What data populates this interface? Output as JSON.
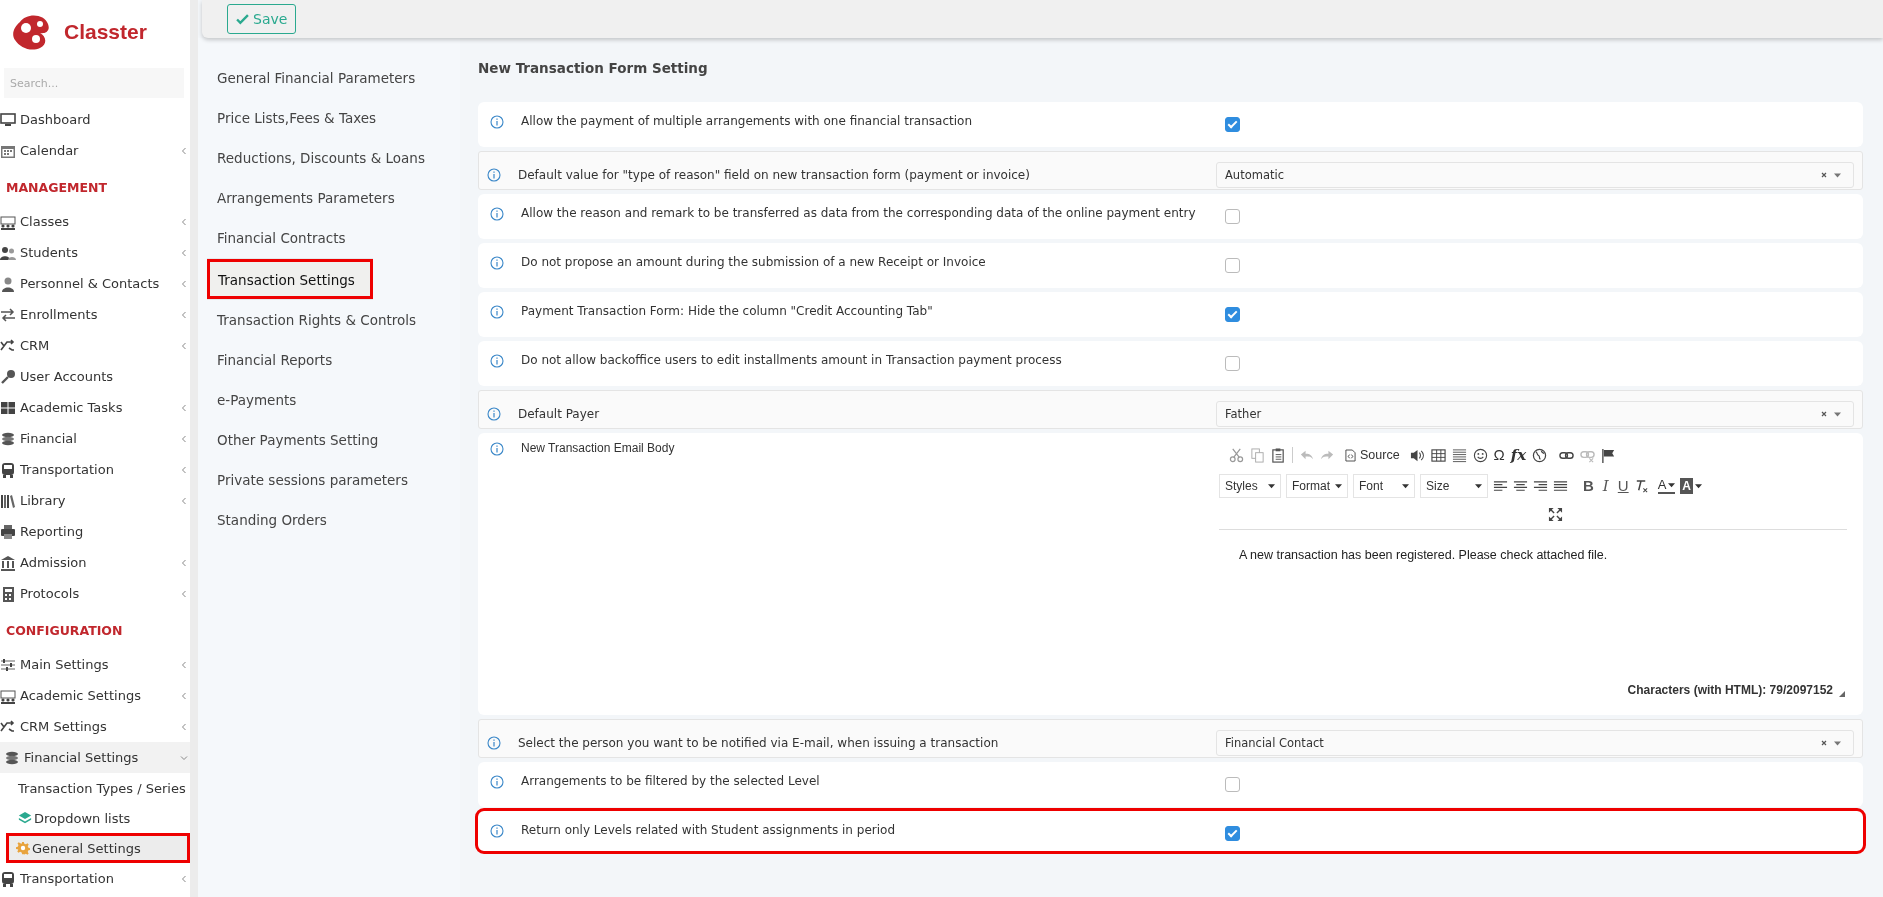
{
  "app": {
    "name": "Classter"
  },
  "sidebar": {
    "search": {
      "placeholder": "Search..."
    },
    "sections": [
      {
        "items": [
          {
            "label": "Dashboard",
            "has_submenu": false
          },
          {
            "label": "Calendar",
            "has_submenu": true,
            "expanded": false
          }
        ]
      },
      {
        "title": "MANAGEMENT",
        "items": [
          {
            "label": "Classes",
            "has_submenu": true,
            "expanded": false
          },
          {
            "label": "Students",
            "has_submenu": true,
            "expanded": false
          },
          {
            "label": "Personnel & Contacts",
            "has_submenu": true,
            "expanded": false
          },
          {
            "label": "Enrollments",
            "has_submenu": true,
            "expanded": false
          },
          {
            "label": "CRM",
            "has_submenu": true,
            "expanded": false
          },
          {
            "label": "User Accounts",
            "has_submenu": false
          },
          {
            "label": "Academic Tasks",
            "has_submenu": true,
            "expanded": false
          },
          {
            "label": "Financial",
            "has_submenu": true,
            "expanded": false
          },
          {
            "label": "Transportation",
            "has_submenu": true,
            "expanded": false
          },
          {
            "label": "Library",
            "has_submenu": true,
            "expanded": false
          },
          {
            "label": "Reporting",
            "has_submenu": false
          },
          {
            "label": "Admission",
            "has_submenu": true,
            "expanded": false
          },
          {
            "label": "Protocols",
            "has_submenu": true,
            "expanded": false
          }
        ]
      },
      {
        "title": "CONFIGURATION",
        "items": [
          {
            "label": "Main Settings",
            "has_submenu": true,
            "expanded": false
          },
          {
            "label": "Academic Settings",
            "has_submenu": true,
            "expanded": false
          },
          {
            "label": "CRM Settings",
            "has_submenu": true,
            "expanded": false
          },
          {
            "label": "Financial Settings",
            "has_submenu": true,
            "expanded": true,
            "children": [
              {
                "label": "Transaction Types / Series",
                "selected": false,
                "highlighted": false
              },
              {
                "label": "Dropdown lists",
                "selected": false,
                "highlighted": false
              },
              {
                "label": "General Settings",
                "selected": true,
                "highlighted": true
              }
            ]
          },
          {
            "label": "Transportation",
            "has_submenu": true,
            "expanded": false
          }
        ]
      }
    ]
  },
  "toolbar": {
    "save_button": "Save"
  },
  "settings_menu": [
    {
      "label": "General Financial Parameters",
      "selected": false,
      "highlighted": false
    },
    {
      "label": "Price Lists,Fees & Taxes",
      "selected": false,
      "highlighted": false
    },
    {
      "label": "Reductions, Discounts & Loans",
      "selected": false,
      "highlighted": false
    },
    {
      "label": "Arrangements Parameters",
      "selected": false,
      "highlighted": false
    },
    {
      "label": "Financial Contracts",
      "selected": false,
      "highlighted": false
    },
    {
      "label": "Transaction Settings",
      "selected": true,
      "highlighted": true
    },
    {
      "label": "Transaction Rights & Controls",
      "selected": false,
      "highlighted": false
    },
    {
      "label": "Financial Reports",
      "selected": false,
      "highlighted": false
    },
    {
      "label": "e-Payments",
      "selected": false,
      "highlighted": false
    },
    {
      "label": "Other Payments Setting",
      "selected": false,
      "highlighted": false
    },
    {
      "label": "Private sessions parameters",
      "selected": false,
      "highlighted": false
    },
    {
      "label": "Standing Orders",
      "selected": false,
      "highlighted": false
    }
  ],
  "form": {
    "title": "New Transaction Form Setting",
    "rows": [
      {
        "kind": "checkbox",
        "label": "Allow the payment of multiple arrangements with one financial transaction",
        "checked": true,
        "highlighted": false
      },
      {
        "kind": "select",
        "label": "Default value for \"type of reason\" field on new transaction form (payment or invoice)",
        "value": "Automatic",
        "highlighted": false
      },
      {
        "kind": "checkbox",
        "label": "Allow the reason and remark to be transferred as data from the corresponding data of the online payment entry",
        "checked": false,
        "highlighted": false
      },
      {
        "kind": "checkbox",
        "label": "Do not propose an amount during the submission of a new Receipt or Invoice",
        "checked": false,
        "highlighted": false
      },
      {
        "kind": "checkbox",
        "label": "Payment Transaction Form: Hide the column \"Credit Accounting Tab\"",
        "checked": true,
        "highlighted": false
      },
      {
        "kind": "checkbox",
        "label": "Do not allow backoffice users to edit installments amount in Transaction payment process",
        "checked": false,
        "highlighted": false
      },
      {
        "kind": "select",
        "label": "Default Payer",
        "value": "Father",
        "highlighted": false
      },
      {
        "kind": "editor",
        "label": "New Transaction Email Body",
        "highlighted": false,
        "editor": {
          "source": "Source",
          "omega": "Ω",
          "formula": "fx",
          "dropdowns": [
            "Styles",
            "Format",
            "Font",
            "Size"
          ],
          "bold": "B",
          "italic": "I",
          "underline": "U",
          "text_color": "A",
          "background_color": "A",
          "content": "A new transaction has been registered. Please check attached file.",
          "counter": "Characters (with HTML): 79/2097152"
        }
      },
      {
        "kind": "select",
        "label": "Select the person you want to be notified via E-mail, when issuing a transaction",
        "value": "Financial Contact",
        "highlighted": false
      },
      {
        "kind": "checkbox",
        "label": "Arrangements to be filtered by the selected Level",
        "checked": false,
        "highlighted": false
      },
      {
        "kind": "checkbox",
        "label": "Return only Levels related with Student assignments in period",
        "checked": true,
        "highlighted": true
      }
    ]
  }
}
